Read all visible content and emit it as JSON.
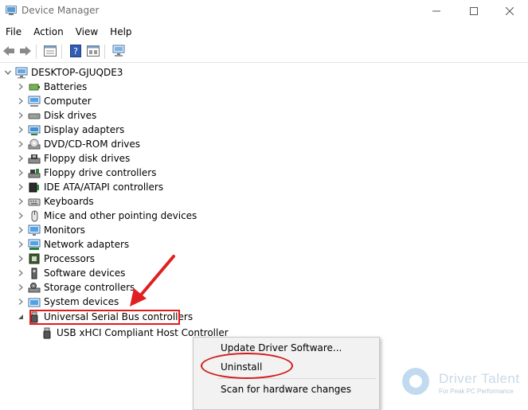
{
  "window": {
    "title": "Device Manager",
    "minimize_glyph": "—",
    "maximize_glyph": "□",
    "close_glyph": "✕"
  },
  "menu": [
    "File",
    "Action",
    "View",
    "Help"
  ],
  "toolbar": {
    "buttons": [
      "back-icon",
      "forward-icon",
      "properties-icon",
      "help-icon",
      "show-hide-icon",
      "scan-hardware-icon"
    ]
  },
  "tree": {
    "root": "DESKTOP-GJUQDE3",
    "categories": [
      {
        "label": "Batteries",
        "icon": "battery-icon"
      },
      {
        "label": "Computer",
        "icon": "computer-icon"
      },
      {
        "label": "Disk drives",
        "icon": "disk-drive-icon"
      },
      {
        "label": "Display adapters",
        "icon": "display-adapter-icon"
      },
      {
        "label": "DVD/CD-ROM drives",
        "icon": "dvd-icon"
      },
      {
        "label": "Floppy disk drives",
        "icon": "floppy-icon"
      },
      {
        "label": "Floppy drive controllers",
        "icon": "floppy-controller-icon"
      },
      {
        "label": "IDE ATA/ATAPI controllers",
        "icon": "ide-icon"
      },
      {
        "label": "Keyboards",
        "icon": "keyboard-icon"
      },
      {
        "label": "Mice and other pointing devices",
        "icon": "mouse-icon"
      },
      {
        "label": "Monitors",
        "icon": "monitor-icon"
      },
      {
        "label": "Network adapters",
        "icon": "network-icon"
      },
      {
        "label": "Processors",
        "icon": "processor-icon"
      },
      {
        "label": "Software devices",
        "icon": "software-device-icon"
      },
      {
        "label": "Storage controllers",
        "icon": "storage-icon"
      },
      {
        "label": "System devices",
        "icon": "system-device-icon"
      },
      {
        "label": "Universal Serial Bus controllers",
        "icon": "usb-icon"
      }
    ],
    "usb_child": "USB xHCI Compliant Host Controller"
  },
  "context_menu": {
    "items": [
      "Update Driver Software...",
      "Uninstall",
      "Scan for hardware changes"
    ]
  },
  "annotations": {
    "highlight_color": "#e21a1a",
    "arrow_color": "#e02020"
  },
  "watermark": {
    "name": "Driver Talent",
    "tagline": "For Peak PC Performance"
  }
}
